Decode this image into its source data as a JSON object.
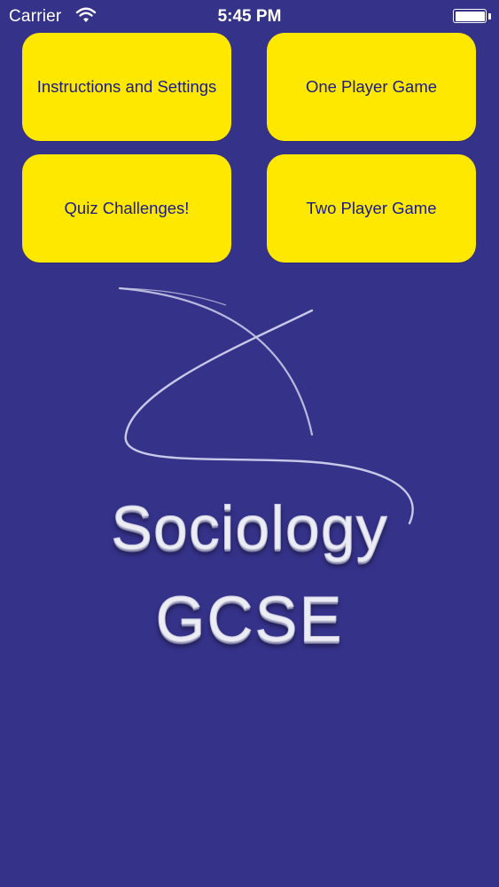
{
  "status_bar": {
    "carrier": "Carrier",
    "time": "5:45 PM",
    "wifi_icon": "wifi-icon",
    "battery_icon": "battery-icon"
  },
  "menu": {
    "instructions_label": "Instructions and Settings",
    "one_player_label": "One Player Game",
    "quiz_label": "Quiz Challenges!",
    "two_player_label": "Two Player Game"
  },
  "logo": {
    "line1": "Sociology",
    "line2": "GCSE"
  },
  "colors": {
    "background": "#35328a",
    "button": "#ffe800",
    "button_text": "#1a1a8a"
  }
}
